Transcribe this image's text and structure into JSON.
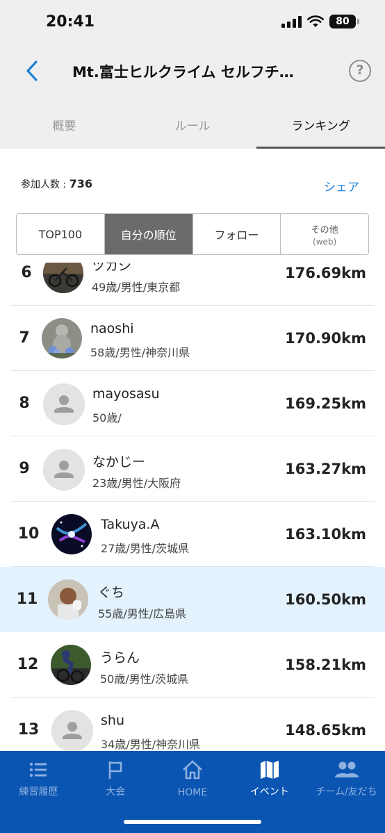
{
  "status_bar": {
    "time": "20:41",
    "battery": "80"
  },
  "nav": {
    "title": "Mt.富士ヒルクライム セルフチ…"
  },
  "tabs": [
    {
      "label": "概要"
    },
    {
      "label": "ルール"
    },
    {
      "label": "ランキング"
    }
  ],
  "participants": {
    "label": "参加人数 : ",
    "count": "736"
  },
  "share_label": "シェア",
  "segments": {
    "top100": "TOP100",
    "mine": "自分の順位",
    "follow": "フォロー",
    "other": "その他",
    "other_sub": "(web)"
  },
  "ranking": [
    {
      "rank": "6",
      "name": "ツカシ",
      "info": "49歳/男性/東京都",
      "distance": "176.69km",
      "avatar": "photo-bike"
    },
    {
      "rank": "7",
      "name": "naoshi",
      "info": "58歳/男性/神奈川県",
      "distance": "170.90km",
      "avatar": "photo-statue"
    },
    {
      "rank": "8",
      "name": "mayosasu",
      "info": "50歳/",
      "distance": "169.25km",
      "avatar": "default-person-icon"
    },
    {
      "rank": "9",
      "name": "なかじー",
      "info": "23歳/男性/大阪府",
      "distance": "163.27km",
      "avatar": "default-person-icon"
    },
    {
      "rank": "10",
      "name": "Takuya.A",
      "info": "27歳/男性/茨城県",
      "distance": "163.10km",
      "avatar": "photo-galaxy"
    },
    {
      "rank": "11",
      "name": "ぐち",
      "info": "55歳/男性/広島県",
      "distance": "160.50km",
      "avatar": "photo-person"
    },
    {
      "rank": "12",
      "name": "うらん",
      "info": "50歳/男性/茨城県",
      "distance": "158.21km",
      "avatar": "photo-cyclist"
    },
    {
      "rank": "13",
      "name": "shu",
      "info": "34歳/男性/神奈川県",
      "distance": "148.65km",
      "avatar": "default-person-icon"
    }
  ],
  "highlight_rank": "11",
  "bottom_nav": [
    {
      "label": "練習履歴",
      "icon": "list-icon"
    },
    {
      "label": "大会",
      "icon": "flag-icon"
    },
    {
      "label": "HOME",
      "icon": "home-icon"
    },
    {
      "label": "イベント",
      "icon": "map-icon"
    },
    {
      "label": "チーム/友だち",
      "icon": "people-icon"
    }
  ],
  "colors": {
    "accent": "#1f7fd6",
    "bottom_nav_bg": "#0b55b2",
    "highlight_row": "#e3f2fd",
    "active_segment": "#6b6b6b"
  }
}
